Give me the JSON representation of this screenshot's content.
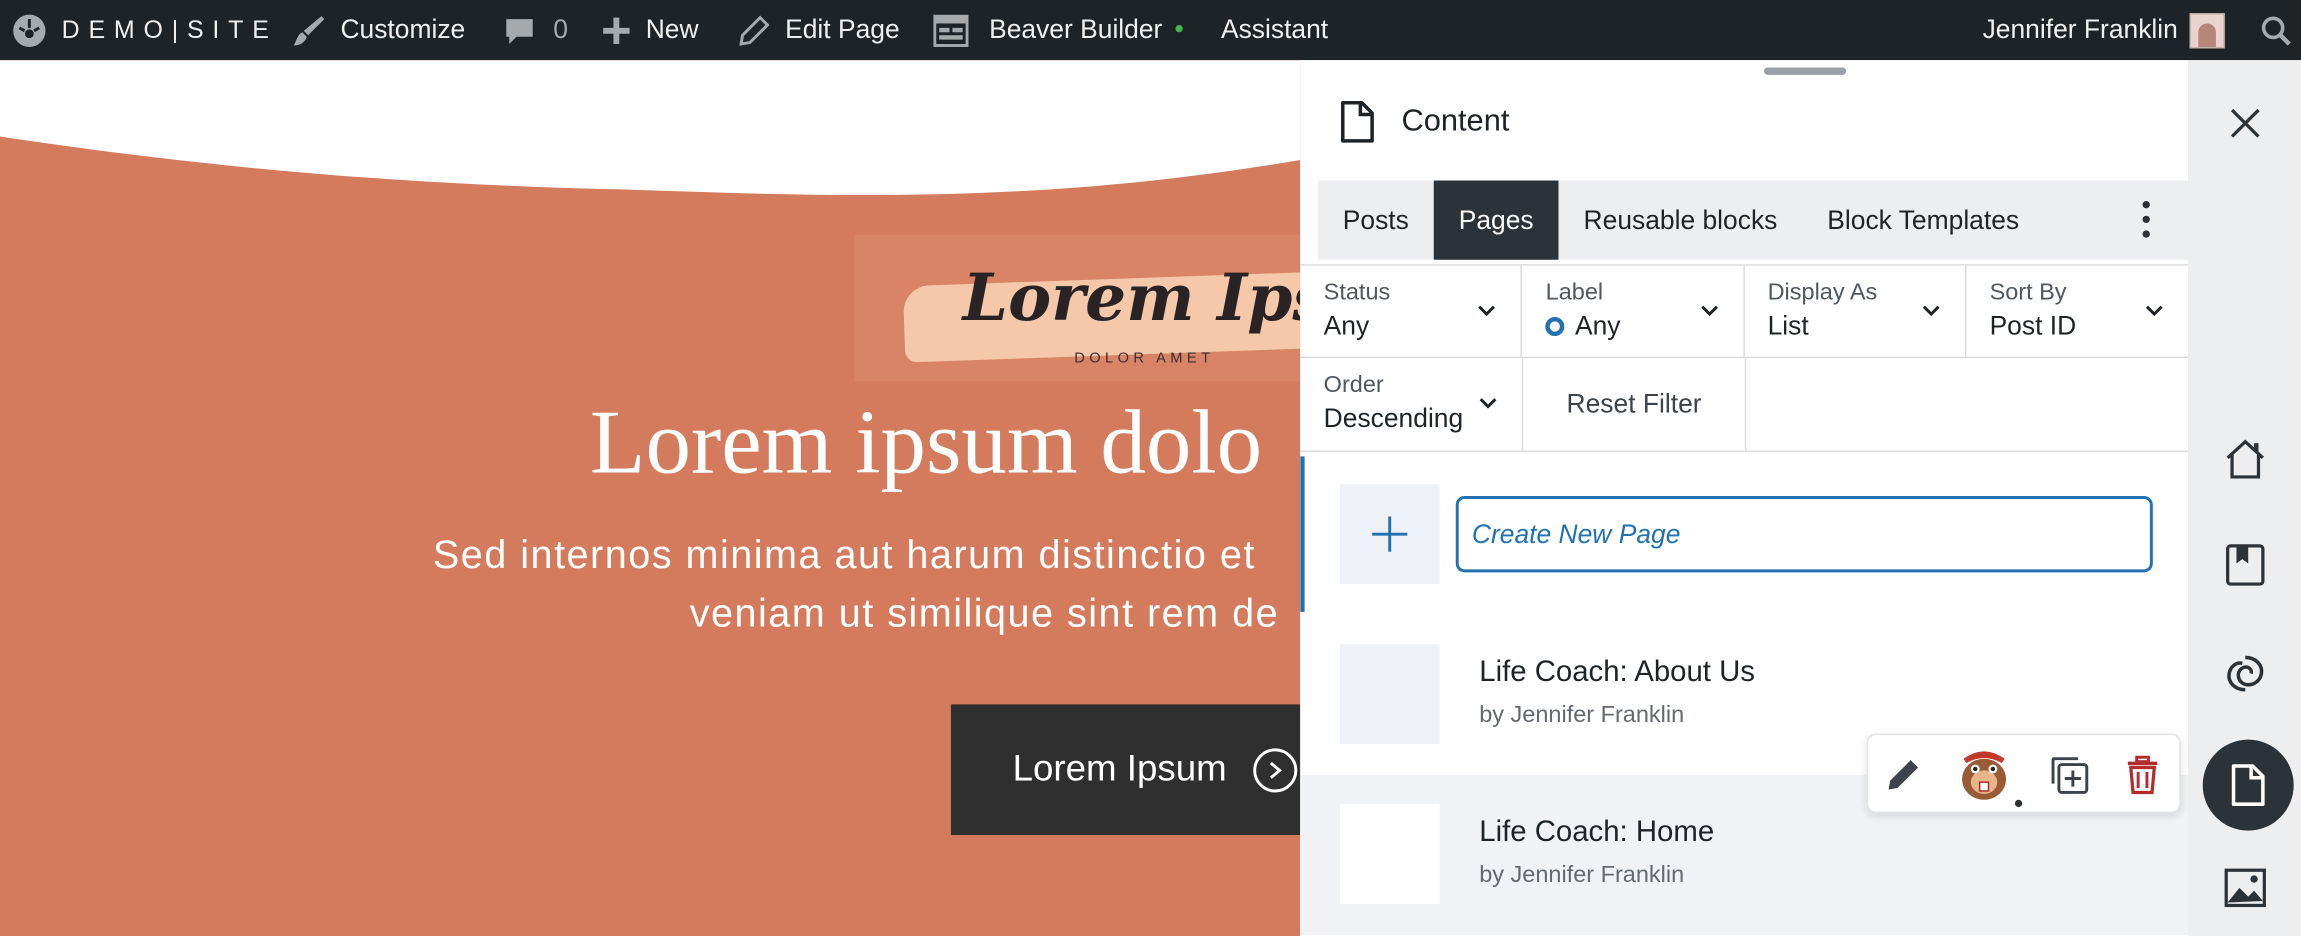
{
  "admin_bar": {
    "site_name": "DEMO|SITE",
    "customize": "Customize",
    "comments_count": "0",
    "new": "New",
    "edit_page": "Edit Page",
    "beaver_builder": "Beaver Builder",
    "assistant": "Assistant",
    "user_name": "Jennifer Franklin",
    "icons": [
      "wordpress-site-icon",
      "brush-icon",
      "comment-icon",
      "plus-icon",
      "pencil-icon",
      "beaver-builder-icon",
      "avatar",
      "search-icon"
    ],
    "status_dot_color": "#46b450"
  },
  "hero": {
    "logo_script": "Lorem Ipsum",
    "logo_tag": "DOLOR AMET",
    "title": "Lorem ipsum dolo",
    "subtitle_line1": "Sed internos minima aut harum distinctio et",
    "subtitle_line2": "veniam ut similique sint rem de",
    "button_label": "Lorem Ipsum",
    "background_color": "#d47b5d"
  },
  "panel": {
    "title": "Content",
    "tabs": [
      {
        "label": "Posts",
        "active": false
      },
      {
        "label": "Pages",
        "active": true
      },
      {
        "label": "Reusable blocks",
        "active": false
      },
      {
        "label": "Block Templates",
        "active": false
      }
    ],
    "filters": {
      "status": {
        "label": "Status",
        "value": "Any"
      },
      "label": {
        "label": "Label",
        "value": "Any"
      },
      "display_as": {
        "label": "Display As",
        "value": "List"
      },
      "sort_by": {
        "label": "Sort By",
        "value": "Post ID"
      },
      "order": {
        "label": "Order",
        "value": "Descending"
      },
      "reset": "Reset Filter"
    },
    "create_placeholder": "Create New Page",
    "pages": [
      {
        "title": "Life Coach: About Us",
        "author": "by Jennifer Franklin"
      },
      {
        "title": "Life Coach: Home",
        "author": "by Jennifer Franklin"
      }
    ],
    "accent_color": "#2271b1"
  },
  "row_actions": [
    "edit-icon",
    "beaver-builder-icon",
    "duplicate-icon",
    "trash-icon"
  ],
  "rail": [
    "close-icon",
    "home-icon",
    "bookmark-icon",
    "swirl-icon",
    "page-icon",
    "media-icon"
  ]
}
